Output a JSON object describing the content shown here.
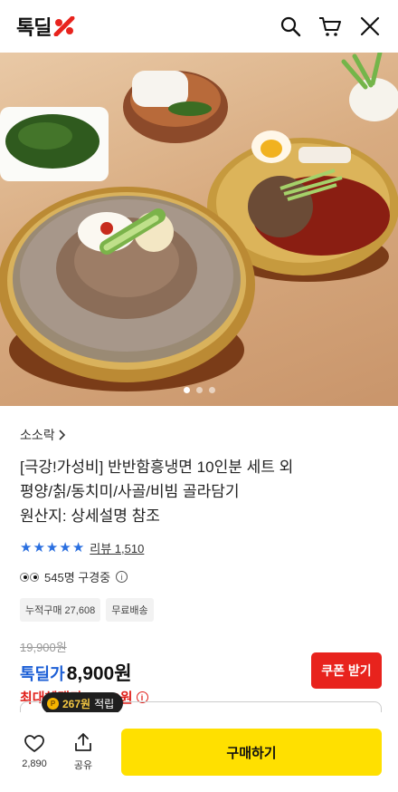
{
  "header": {
    "logo_text": "톡딜",
    "icons": [
      "search-icon",
      "cart-icon",
      "close-icon"
    ]
  },
  "hero": {
    "image_alt": "",
    "dots": [
      true,
      false,
      false
    ]
  },
  "product": {
    "brand": "소소락",
    "title_line1": "[극강!가성비] 반반함흥냉면 10인분 세트 외",
    "title_line2": "평양/칡/동치미/사골/비빔 골라담기",
    "title_line3": "원산지: 상세설명 참조",
    "rating_stars": 5,
    "review_label": "리뷰 1,510",
    "viewers_text": "545명 구경중",
    "badges": [
      "누적구매 27,608",
      "무료배송"
    ]
  },
  "price": {
    "original": "19,900원",
    "label": "톡딜가",
    "value": "8,900원",
    "max_benefit": "최대혜택가 8,800원",
    "coupon_button": "쿠폰 받기"
  },
  "points": {
    "amount": "267원",
    "suffix": "적립"
  },
  "bottom": {
    "like_count": "2,890",
    "share_label": "공유",
    "buy_label": "구매하기"
  },
  "colors": {
    "accent_blue": "#1c5fd6",
    "accent_red": "#e8231d",
    "buy_yellow": "#ffe000"
  }
}
